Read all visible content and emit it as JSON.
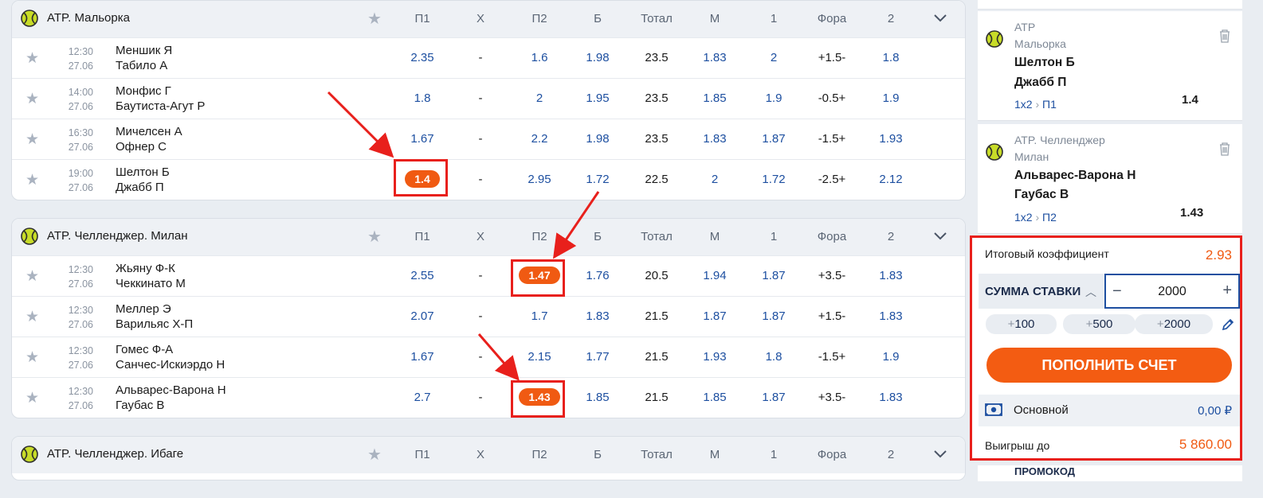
{
  "columns": [
    "П1",
    "X",
    "П2",
    "Б",
    "Тотал",
    "М",
    "1",
    "Фора",
    "2"
  ],
  "leagues": [
    {
      "title": "ATP. Мальорка",
      "matches": [
        {
          "time": "12:30",
          "date": "27.06",
          "team1": "Меншик Я",
          "team2": "Табило А",
          "odds": [
            "2.35",
            "-",
            "1.6",
            "1.98",
            "23.5",
            "1.83",
            "2",
            "+1.5-",
            "1.8"
          ]
        },
        {
          "time": "14:00",
          "date": "27.06",
          "team1": "Монфис Г",
          "team2": "Баутиста-Агут Р",
          "odds": [
            "1.8",
            "-",
            "2",
            "1.95",
            "23.5",
            "1.85",
            "1.9",
            "-0.5+",
            "1.9"
          ]
        },
        {
          "time": "16:30",
          "date": "27.06",
          "team1": "Мичелсен А",
          "team2": "Офнер С",
          "odds": [
            "1.67",
            "-",
            "2.2",
            "1.98",
            "23.5",
            "1.83",
            "1.87",
            "-1.5+",
            "1.93"
          ]
        },
        {
          "time": "19:00",
          "date": "27.06",
          "team1": "Шелтон Б",
          "team2": "Джабб П",
          "odds": [
            "1.4",
            "-",
            "2.95",
            "1.72",
            "22.5",
            "2",
            "1.72",
            "-2.5+",
            "2.12"
          ]
        }
      ]
    },
    {
      "title": "ATP. Челленджер. Милан",
      "matches": [
        {
          "time": "12:30",
          "date": "27.06",
          "team1": "Жьяну Ф-К",
          "team2": "Чеккинато М",
          "odds": [
            "2.55",
            "-",
            "1.47",
            "1.76",
            "20.5",
            "1.94",
            "1.87",
            "+3.5-",
            "1.83"
          ]
        },
        {
          "time": "12:30",
          "date": "27.06",
          "team1": "Меллер Э",
          "team2": "Варильяс Х-П",
          "odds": [
            "2.07",
            "-",
            "1.7",
            "1.83",
            "21.5",
            "1.87",
            "1.87",
            "+1.5-",
            "1.83"
          ]
        },
        {
          "time": "12:30",
          "date": "27.06",
          "team1": "Гомес Ф-А",
          "team2": "Санчес-Искиэрдо Н",
          "odds": [
            "1.67",
            "-",
            "2.15",
            "1.77",
            "21.5",
            "1.93",
            "1.8",
            "-1.5+",
            "1.9"
          ]
        },
        {
          "time": "12:30",
          "date": "27.06",
          "team1": "Альварес-Варона Н",
          "team2": "Гаубас В",
          "odds": [
            "2.7",
            "-",
            "1.43",
            "1.85",
            "21.5",
            "1.85",
            "1.87",
            "+3.5-",
            "1.83"
          ]
        }
      ]
    },
    {
      "title": "ATP. Челленджер. Ибаге",
      "matches": []
    }
  ],
  "coupon": [
    {
      "league1": "ATP",
      "league2": "Мальорка",
      "team1": "Шелтон Б",
      "team2": "Джабб П",
      "market": "1x2",
      "outcome": "П1",
      "odd": "1.4"
    },
    {
      "league1": "ATP. Челленджер",
      "league2": "Милан",
      "team1": "Альварес-Варона Н",
      "team2": "Гаубас В",
      "market": "1x2",
      "outcome": "П2",
      "odd": "1.43"
    }
  ],
  "slip": {
    "total_label": "Итоговый коэффициент",
    "total_value": "2.93",
    "stake_label": "СУММА СТАВКИ",
    "stake_value": "2000",
    "quick": [
      "100",
      "500",
      "2000"
    ],
    "topup_label": "ПОПОЛНИТЬ СЧЕТ",
    "account_label": "Основной",
    "account_value": "0,00 ₽",
    "win_label": "Выигрыш до",
    "win_value": "5 860.00"
  },
  "promo_label": "ПРОМОКОД",
  "colors": {
    "accent": "#f05a12",
    "link": "#1d4fa0",
    "highlight_box": "#e8201c"
  }
}
